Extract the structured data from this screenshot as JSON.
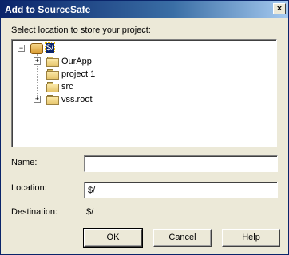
{
  "window": {
    "title": "Add to SourceSafe",
    "close_glyph": "×"
  },
  "prompt": "Select location to store your project:",
  "tree": {
    "root": {
      "label": "$/",
      "icon": "sourcesafe-database-icon",
      "expander": "−"
    },
    "items": [
      {
        "label": "OurApp",
        "expander": "+"
      },
      {
        "label": "project 1",
        "expander": ""
      },
      {
        "label": "src",
        "expander": ""
      },
      {
        "label": "vss.root",
        "expander": "+"
      }
    ]
  },
  "form": {
    "name_label": "Name:",
    "name_value": "",
    "location_label": "Location:",
    "location_value": "$/",
    "destination_label": "Destination:",
    "destination_value": "$/"
  },
  "buttons": {
    "ok": "OK",
    "cancel": "Cancel",
    "help": "Help"
  },
  "colors": {
    "title_bar": "#0a246a",
    "dialog_face": "#ece9d8",
    "selection": "#0a246a"
  }
}
